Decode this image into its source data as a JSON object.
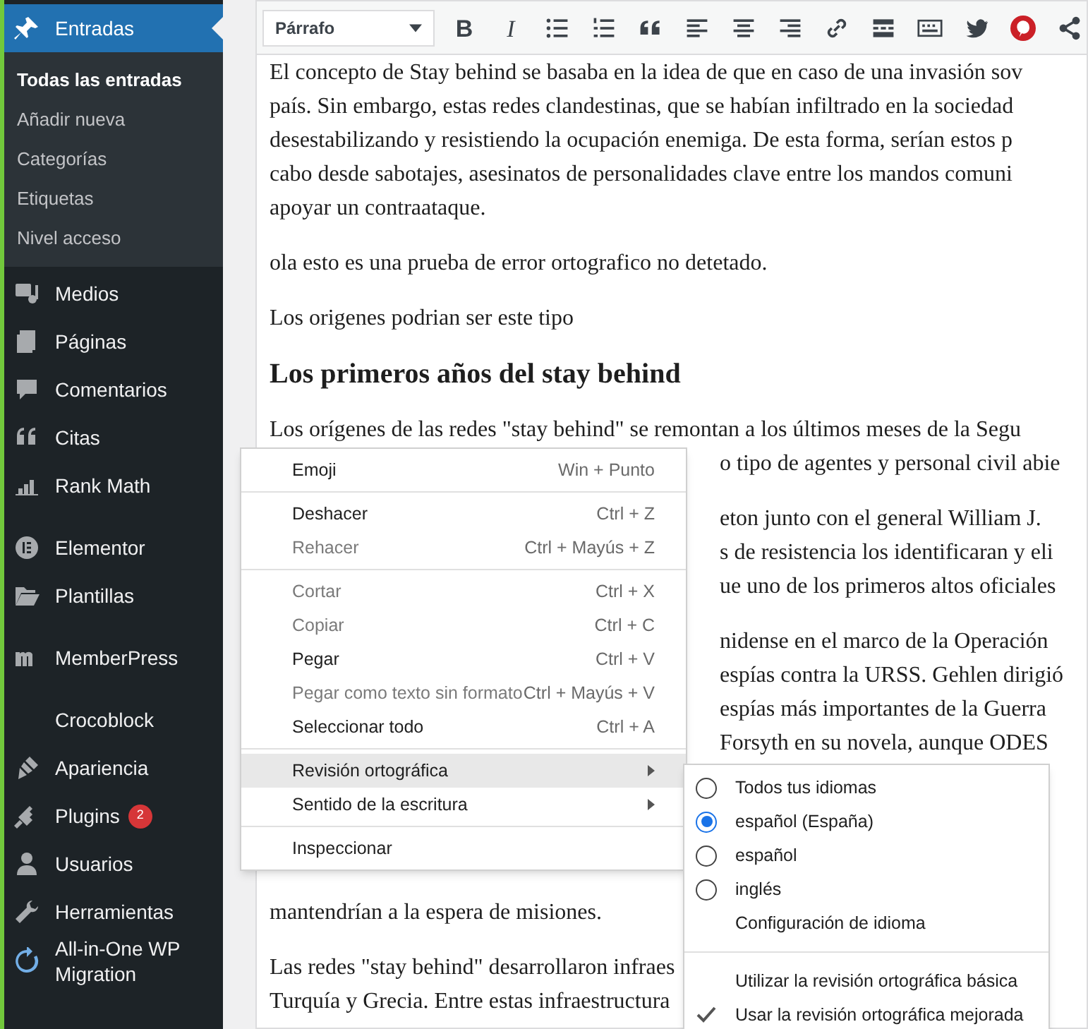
{
  "sidebar": {
    "current": {
      "label": "Entradas",
      "selected": true
    },
    "submenu": [
      {
        "label": "Todas las entradas",
        "selected": true
      },
      {
        "label": "Añadir nueva",
        "selected": false
      },
      {
        "label": "Categorías",
        "selected": false
      },
      {
        "label": "Etiquetas",
        "selected": false
      },
      {
        "label": "Nivel acceso",
        "selected": false
      }
    ],
    "items": [
      {
        "label": "Medios"
      },
      {
        "label": "Páginas"
      },
      {
        "label": "Comentarios"
      },
      {
        "label": "Citas"
      },
      {
        "label": "Rank Math"
      },
      {
        "label": "Elementor"
      },
      {
        "label": "Plantillas"
      },
      {
        "label": "MemberPress"
      },
      {
        "label": "Crocoblock"
      },
      {
        "label": "Apariencia"
      },
      {
        "label": "Plugins",
        "badge": "2"
      },
      {
        "label": "Usuarios"
      },
      {
        "label": "Herramientas"
      },
      {
        "label": "All-in-One WP Migration"
      }
    ]
  },
  "toolbar": {
    "format": "Párrafo",
    "bold": "B",
    "italic": "I"
  },
  "editor": {
    "blocks": [
      {
        "kind": "paragraph",
        "lines": [
          {
            "kind": "full",
            "text": "El concepto de Stay behind se basaba en la idea de que en caso de una invasión sov"
          },
          {
            "kind": "full",
            "text": "país. Sin embargo, estas redes clandestinas, que se habían infiltrado en la sociedad"
          },
          {
            "kind": "full",
            "text": "desestabilizando y resistiendo la ocupación enemiga. De esta forma, serían estos p"
          },
          {
            "kind": "full",
            "text": "cabo desde sabotajes, asesinatos de personalidades clave entre los mandos comuni"
          },
          {
            "kind": "full",
            "text": "apoyar un contraataque."
          }
        ]
      },
      {
        "kind": "paragraph",
        "lines": [
          {
            "kind": "full",
            "text": "ola esto es una prueba de error ortografico no detetado."
          }
        ]
      },
      {
        "kind": "paragraph",
        "lines": [
          {
            "kind": "full",
            "text": "Los origenes podrian ser este tipo"
          }
        ]
      },
      {
        "kind": "heading",
        "lines": [
          {
            "kind": "full",
            "text": "Los primeros años del stay behind"
          }
        ]
      },
      {
        "kind": "paragraph",
        "lines": [
          {
            "kind": "full",
            "text": "Los orígenes de las redes \"stay behind\" se remontan a los últimos meses de la Segu"
          },
          {
            "kind": "partial",
            "text": "o tipo de agentes y personal civil abie"
          }
        ]
      },
      {
        "kind": "paragraph",
        "lines": [
          {
            "kind": "partial",
            "text": "eton junto con el general William J."
          },
          {
            "kind": "partial",
            "text": "s de resistencia los identificaran y eli"
          },
          {
            "kind": "partial",
            "text": "ue uno de los primeros altos oficiales"
          }
        ]
      },
      {
        "kind": "paragraph",
        "lines": [
          {
            "kind": "partial",
            "text": "nidense en el marco de la Operación"
          },
          {
            "kind": "partial",
            "text": "espías contra la URSS. Gehlen dirigió"
          },
          {
            "kind": "partial",
            "text": "espías más importantes de la Guerra"
          },
          {
            "kind": "partial",
            "text": "Forsyth en su novela, aunque ODES"
          },
          {
            "kind": "hidden"
          },
          {
            "kind": "hidden"
          },
          {
            "kind": "hidden"
          },
          {
            "kind": "hidden"
          },
          {
            "kind": "full",
            "text": "mantendrían a la espera de misiones."
          }
        ]
      },
      {
        "kind": "paragraph",
        "lines": [
          {
            "kind": "full",
            "text": "Las redes \"stay behind\" desarrollaron infraes"
          },
          {
            "kind": "full",
            "text": "Turquía y Grecia. Entre estas infraestructura"
          }
        ]
      }
    ]
  },
  "context_menu": {
    "groups": [
      [
        {
          "label": "Emoji",
          "shortcut": "Win + Punto",
          "disabled": false
        }
      ],
      [
        {
          "label": "Deshacer",
          "shortcut": "Ctrl + Z",
          "disabled": false
        },
        {
          "label": "Rehacer",
          "shortcut": "Ctrl + Mayús + Z",
          "disabled": true
        }
      ],
      [
        {
          "label": "Cortar",
          "shortcut": "Ctrl + X",
          "disabled": true
        },
        {
          "label": "Copiar",
          "shortcut": "Ctrl + C",
          "disabled": true
        },
        {
          "label": "Pegar",
          "shortcut": "Ctrl + V",
          "disabled": false
        },
        {
          "label": "Pegar como texto sin formato",
          "shortcut": "Ctrl + Mayús + V",
          "disabled": true
        },
        {
          "label": "Seleccionar todo",
          "shortcut": "Ctrl + A",
          "disabled": false
        }
      ],
      [
        {
          "label": "Revisión ortográfica",
          "submenu": true,
          "selected": true,
          "disabled": false
        },
        {
          "label": "Sentido de la escritura",
          "submenu": true,
          "selected": false,
          "disabled": false
        }
      ],
      [
        {
          "label": "Inspeccionar",
          "disabled": false
        }
      ]
    ]
  },
  "spell_submenu": {
    "groups": [
      [
        {
          "kind": "radio",
          "label": "Todos tus idiomas",
          "checked": false
        },
        {
          "kind": "radio",
          "label": "español (España)",
          "checked": true
        },
        {
          "kind": "radio",
          "label": "español",
          "checked": false
        },
        {
          "kind": "radio",
          "label": "inglés",
          "checked": false
        },
        {
          "kind": "plain",
          "label": "Configuración de idioma"
        }
      ],
      [
        {
          "kind": "check",
          "label": "Utilizar la revisión ortográfica básica",
          "checked": false
        },
        {
          "kind": "check",
          "label": "Usar la revisión ortográfica mejorada",
          "checked": true
        }
      ]
    ]
  }
}
